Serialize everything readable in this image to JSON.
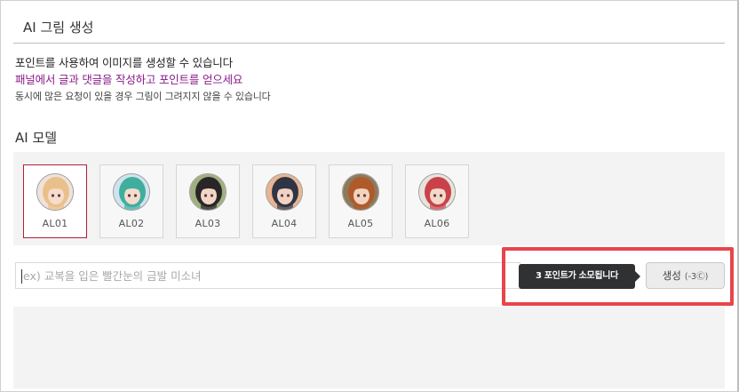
{
  "header": {
    "title": "AI 그림 생성"
  },
  "descriptions": {
    "line1": "포인트를 사용하여 이미지를 생성할 수 있습니다",
    "line2": "패널에서 글과 댓글을 작성하고 포인트를 얻으세요",
    "line3": "동시에 많은 요청이 있을 경우 그림이 그려지지 않을 수 있습니다"
  },
  "models": {
    "label": "AI 모델",
    "selected": "AL01",
    "items": [
      {
        "label": "AL01",
        "hair": "#e9c08a",
        "bg": "#efe2d8",
        "skin": "#f6dccb"
      },
      {
        "label": "AL02",
        "hair": "#3fae9c",
        "bg": "#cfe3ef",
        "skin": "#f3dccd"
      },
      {
        "label": "AL03",
        "hair": "#2a2628",
        "bg": "#9fb07e",
        "skin": "#f2d6c4"
      },
      {
        "label": "AL04",
        "hair": "#2f3446",
        "bg": "#e9b48f",
        "skin": "#f2d3c1"
      },
      {
        "label": "AL05",
        "hair": "#b05a2b",
        "bg": "#8d7a5c",
        "skin": "#f3d3bd"
      },
      {
        "label": "AL06",
        "hair": "#c9424a",
        "bg": "#e7e3dc",
        "skin": "#f4d8c8"
      }
    ]
  },
  "prompt": {
    "placeholder": "ex) 교복을 입은 빨간눈의 금발 미소녀",
    "value": ""
  },
  "tooltip": {
    "text": "3 포인트가 소모됩니다"
  },
  "generate": {
    "label": "생성",
    "cost": "(-3Ⓒ)"
  },
  "colors": {
    "selected_border": "#b3213a",
    "link_purple": "#8a1b8a",
    "highlight_red": "#e8454a",
    "tooltip_bg": "#2f3133"
  }
}
